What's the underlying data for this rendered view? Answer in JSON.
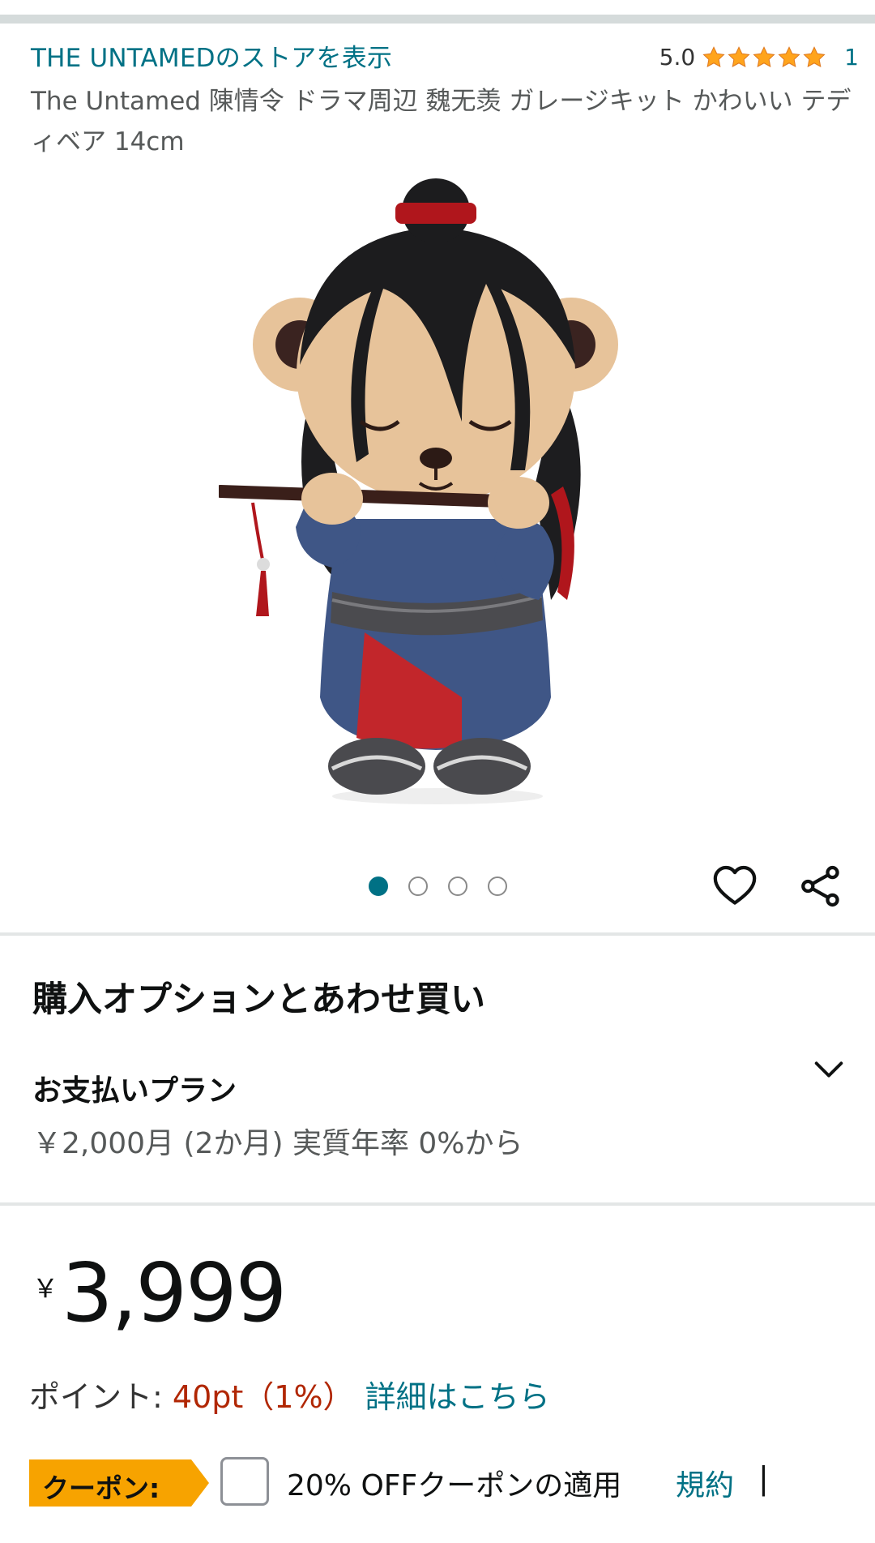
{
  "header": {
    "store_link": "THE UNTAMEDのストアを表示",
    "rating_score": "5.0",
    "rating_count": "1",
    "stars": 5
  },
  "product": {
    "title": "The Untamed 陳情令 ドラマ周辺 魏无羡 ガレージキット かわいい テディベア 14cm",
    "image_count": 4,
    "active_image": 1
  },
  "options": {
    "section_title": "購入オプションとあわせ買い",
    "plan_label": "お支払いプラン",
    "plan_detail": "￥2,000月 (2か月) 実質年率 0%から"
  },
  "price": {
    "symbol": "￥",
    "value": "3,999"
  },
  "points": {
    "label": "ポイント: ",
    "value": "40pt（1%）",
    "link": "詳細はこちら"
  },
  "coupon": {
    "badge": "クーポン:",
    "text": "20% OFFクーポンの適用",
    "terms": "規約",
    "separator": "|"
  },
  "colors": {
    "link": "#007185",
    "price_red": "#b12704",
    "coupon_orange": "#f7a300",
    "star": "#ffa41c"
  }
}
